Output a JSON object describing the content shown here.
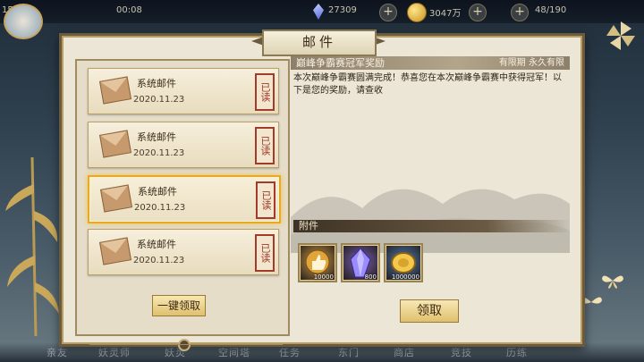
{
  "top_bar": {
    "level": "150",
    "time": "00:08",
    "crystal_count": "27309",
    "gold_count": "3047万",
    "stamina": "48/190"
  },
  "panel": {
    "title": "邮件"
  },
  "mail_list": {
    "items": [
      {
        "name": "系统邮件",
        "date": "2020.11.23",
        "status": "已读",
        "selected": false
      },
      {
        "name": "系统邮件",
        "date": "2020.11.23",
        "status": "已读",
        "selected": false
      },
      {
        "name": "系统邮件",
        "date": "2020.11.23",
        "status": "已读",
        "selected": true
      },
      {
        "name": "系统邮件",
        "date": "2020.11.23",
        "status": "已读",
        "selected": false
      }
    ],
    "claim_all_label": "一键领取"
  },
  "detail": {
    "title": "巅峰争霸赛冠军奖励",
    "expiry": "有限期 永久有限",
    "body": "本次巅峰争霸赛圆满完成！恭喜您在本次巅峰争霸赛中获得冠军！以下是您的奖励，请查收",
    "attachments_label": "附件",
    "rewards": [
      {
        "icon": "thumbs-up-token-icon",
        "count": "10000",
        "color": "#c98b2e"
      },
      {
        "icon": "purple-crystal-icon",
        "count": "800",
        "color": "#5b3fa8"
      },
      {
        "icon": "gold-coin-icon",
        "count": "1000000",
        "color": "#2e5fae"
      }
    ],
    "claim_label": "领取"
  },
  "bottom_nav": [
    "亲友",
    "妖灵师",
    "妖灵",
    "空间塔",
    "任务",
    "东门",
    "商店",
    "竞技",
    "历练"
  ]
}
